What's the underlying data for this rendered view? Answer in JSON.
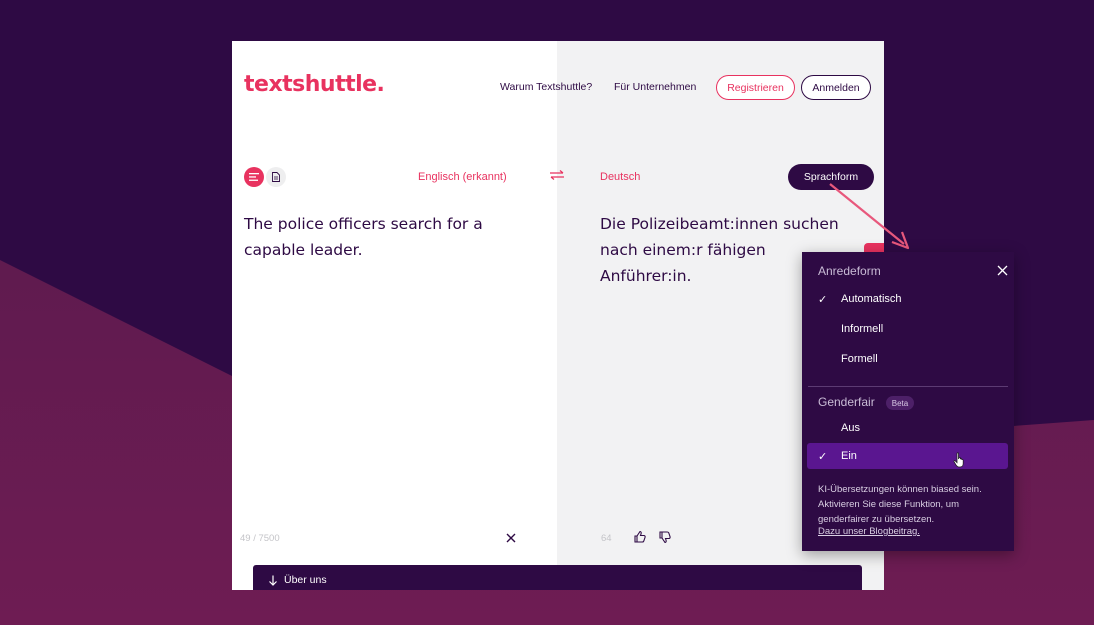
{
  "header": {
    "logo": "textshuttle.",
    "nav": [
      "Warum Textshuttle?",
      "Für Unternehmen"
    ],
    "register_label": "Registrieren",
    "login_label": "Anmelden"
  },
  "translator": {
    "mode_icons": [
      "text-mode-icon",
      "document-mode-icon"
    ],
    "source_language": "Englisch (erkannt)",
    "target_language": "Deutsch",
    "sprachform_label": "Sprachform",
    "source_text": "The police officers search for a capable leader.",
    "target_text": "Die Polizeibeamt:innen suchen nach einem:r fähigen Anführer:in.",
    "source_count": "49 / 7500",
    "target_count": "64"
  },
  "footer": {
    "about_label": "Über uns"
  },
  "sprachform_panel": {
    "anrede_heading": "Anredeform",
    "anrede_options": [
      {
        "label": "Automatisch",
        "checked": true
      },
      {
        "label": "Informell",
        "checked": false
      },
      {
        "label": "Formell",
        "checked": false
      }
    ],
    "gender_heading": "Genderfair",
    "beta_label": "Beta",
    "gender_options": [
      {
        "label": "Aus",
        "checked": false
      },
      {
        "label": "Ein",
        "checked": true
      }
    ],
    "check_glyph": "✓",
    "info_text": "KI-Übersetzungen können biased sein. Aktivieren Sie diese Funktion, um genderfairer zu übersetzen.",
    "link_text": "Dazu unser Blogbeitrag."
  },
  "colors": {
    "brand_pink": "#e8325f",
    "brand_purple": "#2e0a44",
    "selected_option": "#5a1690"
  }
}
